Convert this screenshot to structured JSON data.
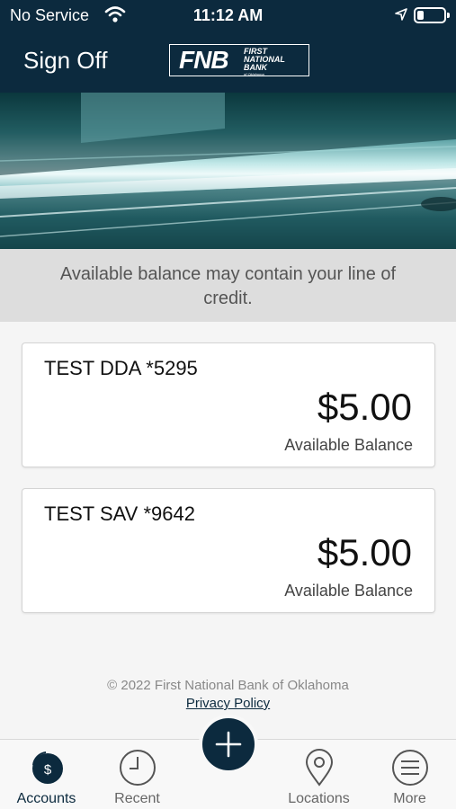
{
  "status": {
    "carrier": "No Service",
    "time": "11:12 AM"
  },
  "header": {
    "sign_off": "Sign Off",
    "logo_mark": "FNB",
    "logo_line1": "FIRST",
    "logo_line2": "NATIONAL",
    "logo_line3": "BANK",
    "logo_line4": "of Oklahoma"
  },
  "notice": "Available balance may contain your line of credit.",
  "accounts": [
    {
      "name": "TEST DDA *5295",
      "amount": "$5.00",
      "label": "Available Balance"
    },
    {
      "name": "TEST SAV *9642",
      "amount": "$5.00",
      "label": "Available Balance"
    }
  ],
  "footer": {
    "copyright": "© 2022 First National Bank of Oklahoma",
    "privacy": "Privacy Policy"
  },
  "tabs": [
    {
      "label": "Accounts",
      "icon": "accounts-icon"
    },
    {
      "label": "Recent",
      "icon": "clock-icon"
    },
    {
      "label": "Locations",
      "icon": "location-pin-icon"
    },
    {
      "label": "More",
      "icon": "menu-icon"
    }
  ],
  "colors": {
    "brand_navy": "#0c2a3e",
    "notice_bg": "#dddddd",
    "page_bg": "#f5f5f5"
  }
}
